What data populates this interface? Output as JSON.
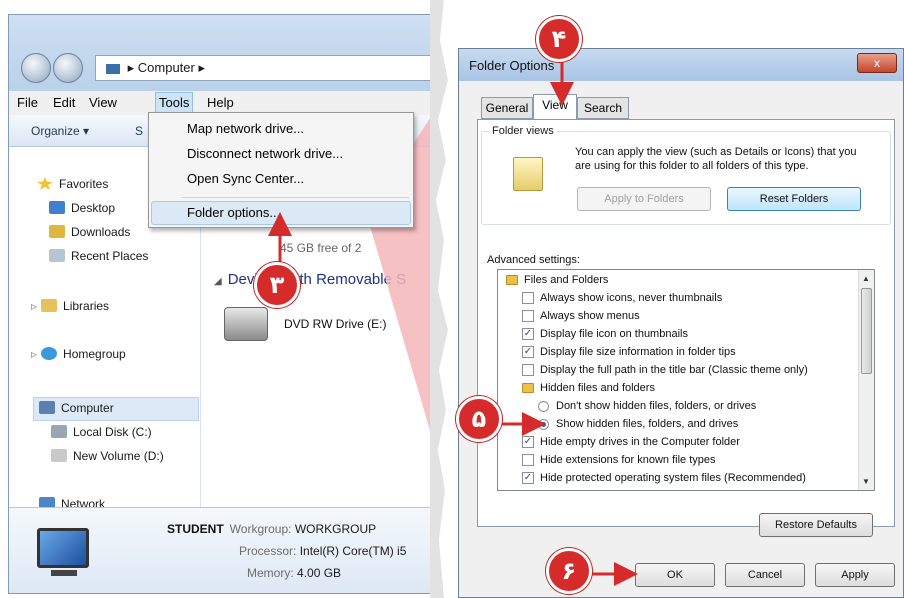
{
  "explorer": {
    "address": [
      "Computer",
      "▸"
    ],
    "menu": [
      "File",
      "Edit",
      "View",
      "Tools",
      "Help"
    ],
    "toolbar": {
      "organize": "Organize ▾",
      "cut_letter": "S"
    },
    "nav": {
      "favorites": "Favorites",
      "desktop": "Desktop",
      "downloads": "Downloads",
      "recent": "Recent Places",
      "libraries": "Libraries",
      "homegroup": "Homegroup",
      "computer": "Computer",
      "local_disk": "Local Disk (C:)",
      "new_volume": "New Volume (D:)",
      "network": "Network"
    },
    "content": {
      "free_space": "45 GB free of 2",
      "removable_header": "Devices with Removable S",
      "dvd": "DVD RW Drive (E:)"
    },
    "details": {
      "name": "STUDENT",
      "workgroup_key": "Workgroup:",
      "workgroup_val": "WORKGROUP",
      "processor_key": "Processor:",
      "processor_val": "Intel(R) Core(TM) i5",
      "memory_key": "Memory:",
      "memory_val": "4.00 GB"
    }
  },
  "tools_menu": {
    "items": [
      "Map network drive...",
      "Disconnect network drive...",
      "Open Sync Center...",
      "Folder options..."
    ],
    "highlighted": "Folder options..."
  },
  "dialog": {
    "title": "Folder Options",
    "close": "x",
    "tabs": [
      "General",
      "View",
      "Search"
    ],
    "active_tab": "View",
    "folder_views_legend": "Folder views",
    "folder_views_desc": "You can apply the view (such as Details or Icons) that you are using for this folder to all folders of this type.",
    "apply_to_folders": "Apply to Folders",
    "reset_folders": "Reset Folders",
    "advanced_label": "Advanced settings:",
    "settings": [
      {
        "kind": "folder",
        "text": "Files and Folders",
        "indent": 0
      },
      {
        "kind": "checkbox",
        "checked": false,
        "text": "Always show icons, never thumbnails",
        "indent": 1
      },
      {
        "kind": "checkbox",
        "checked": false,
        "text": "Always show menus",
        "indent": 1
      },
      {
        "kind": "checkbox",
        "checked": true,
        "text": "Display file icon on thumbnails",
        "indent": 1
      },
      {
        "kind": "checkbox",
        "checked": true,
        "text": "Display file size information in folder tips",
        "indent": 1
      },
      {
        "kind": "checkbox",
        "checked": false,
        "text": "Display the full path in the title bar (Classic theme only)",
        "indent": 1
      },
      {
        "kind": "folder",
        "text": "Hidden files and folders",
        "indent": 1
      },
      {
        "kind": "radio",
        "checked": false,
        "text": "Don't show hidden files, folders, or drives",
        "indent": 2
      },
      {
        "kind": "radio",
        "checked": true,
        "text": "Show hidden files, folders, and drives",
        "indent": 2
      },
      {
        "kind": "checkbox",
        "checked": true,
        "text": "Hide empty drives in the Computer folder",
        "indent": 1
      },
      {
        "kind": "checkbox",
        "checked": false,
        "text": "Hide extensions for known file types",
        "indent": 1
      },
      {
        "kind": "checkbox",
        "checked": true,
        "text": "Hide protected operating system files (Recommended)",
        "indent": 1
      }
    ],
    "restore_defaults": "Restore Defaults",
    "ok": "OK",
    "cancel": "Cancel",
    "apply": "Apply"
  },
  "steps": [
    "۳",
    "۴",
    "۵",
    "۶"
  ],
  "colors": {
    "step_red": "#d52b2b",
    "zoom_wedge": "#f4b6b8"
  }
}
